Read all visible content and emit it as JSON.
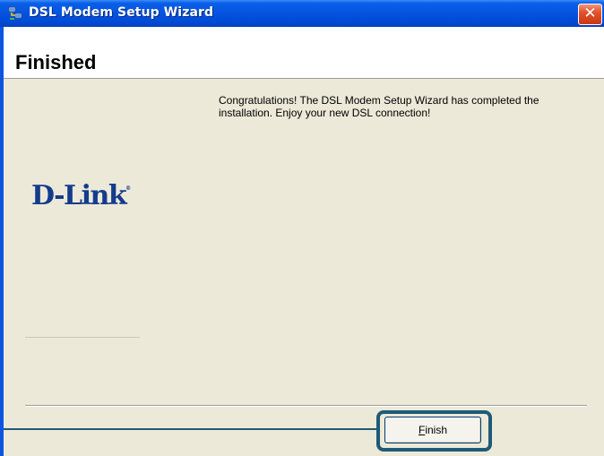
{
  "window": {
    "title": "DSL Modem Setup Wizard",
    "icon": "network-setup-icon",
    "close_glyph": "✕"
  },
  "header": {
    "title": "Finished"
  },
  "content": {
    "message": "Congratulations!  The DSL Modem Setup Wizard has completed the installation.  Enjoy your new DSL connection!",
    "logo_text": "D-Link",
    "logo_mark": "®"
  },
  "buttons": {
    "finish_mnemonic": "F",
    "finish_rest": "inish"
  },
  "colors": {
    "titlebar": "#0553df",
    "body_background": "#ece9d8",
    "logo": "#143c8c",
    "callout": "#1e5a78"
  }
}
